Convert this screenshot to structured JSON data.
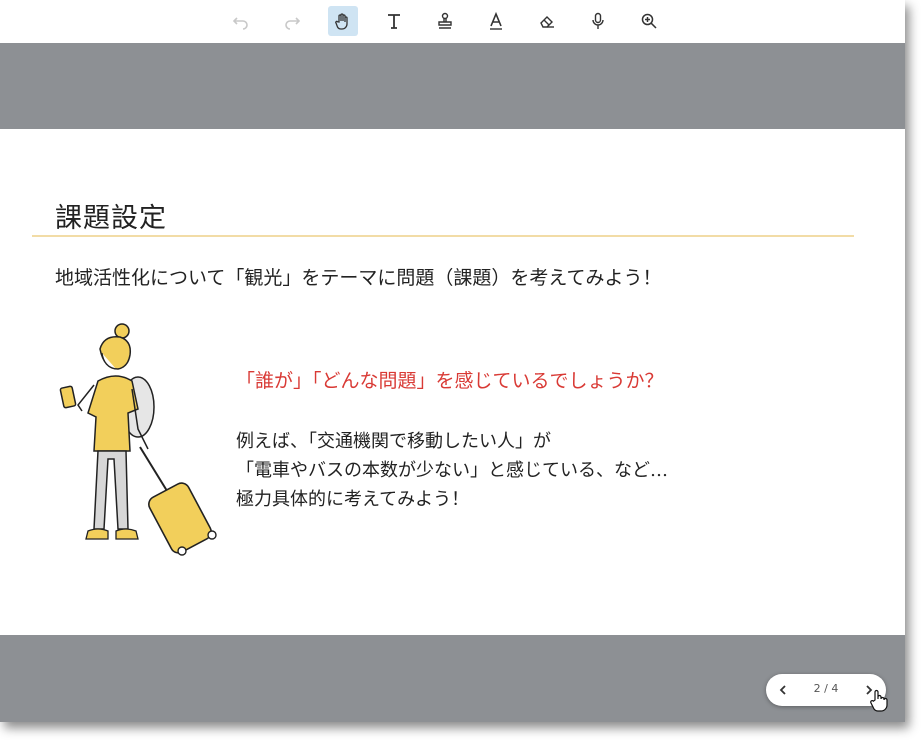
{
  "toolbar": {
    "icons": [
      "undo-icon",
      "redo-icon",
      "hand-pan-icon",
      "text-icon",
      "stamp-icon",
      "highlighter-icon",
      "eraser-icon",
      "microphone-icon",
      "zoom-icon"
    ],
    "active_tool": "hand-pan-icon",
    "accent_color": "#cfe4f3"
  },
  "slide": {
    "title": "課題設定",
    "intro": "地域活性化について「観光」をテーマに問題（課題）を考えてみよう！",
    "question": "「誰が」「どんな問題」を感じているでしょうか？",
    "example_lines": [
      "例えば、「交通機関で移動したい人」が",
      "「電車やバスの本数が少ない」と感じている、など…",
      "極力具体的に考えてみよう！"
    ],
    "question_color": "#d93a35",
    "rule_color": "#f2dca6"
  },
  "pager": {
    "page_text": "2 / 4"
  },
  "colors": {
    "backdrop": "#8d9094"
  }
}
